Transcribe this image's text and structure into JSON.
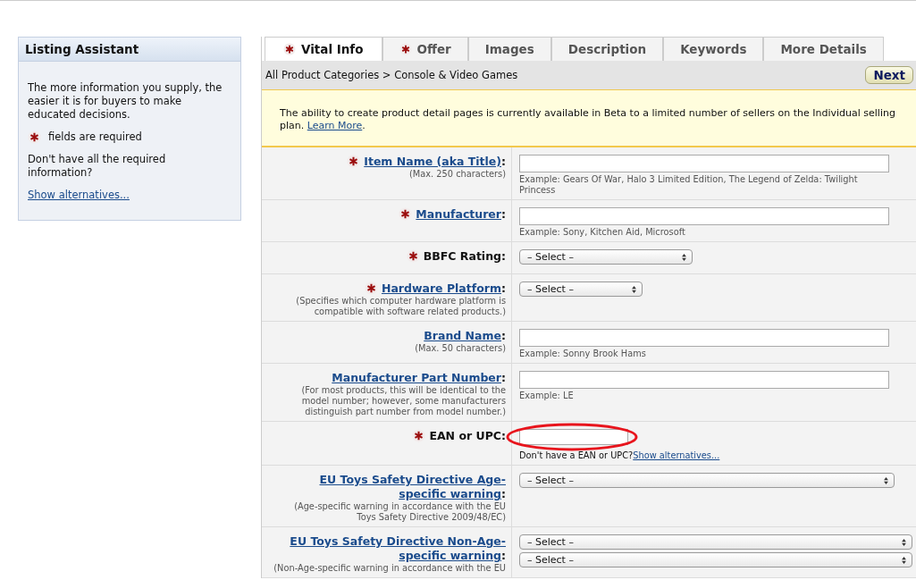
{
  "assistant": {
    "title": "Listing Assistant",
    "intro": "The more information you supply, the easier it is for buyers to make educated decisions.",
    "required_note": "fields are required",
    "missing_text": "Don't have all the required information?",
    "missing_link": "Show alternatives..."
  },
  "tabs": [
    {
      "label": "Vital Info",
      "required": true,
      "selected": true
    },
    {
      "label": "Offer",
      "required": true,
      "selected": false
    },
    {
      "label": "Images",
      "required": false,
      "selected": false
    },
    {
      "label": "Description",
      "required": false,
      "selected": false
    },
    {
      "label": "Keywords",
      "required": false,
      "selected": false
    },
    {
      "label": "More Details",
      "required": false,
      "selected": false
    }
  ],
  "breadcrumb": "All Product Categories > Console & Video Games",
  "next_button": "Next",
  "notice": {
    "text": "The ability to create product detail pages is currently available in Beta to a limited number of sellers on the Individual selling plan. ",
    "link": "Learn More",
    "end": "."
  },
  "fields": [
    {
      "label": "Item Name (aka Title)",
      "colon": ":",
      "required": true,
      "link": true,
      "note": "(Max. 250 characters)",
      "kind": "text",
      "example": "Example: Gears Of War, Halo 3 Limited Edition, The Legend of Zelda: Twilight Princess"
    },
    {
      "label": "Manufacturer",
      "colon": ":",
      "required": true,
      "link": true,
      "kind": "text",
      "example": "Example: Sony, Kitchen Aid, Microsoft"
    },
    {
      "label": "BBFC Rating:",
      "required": true,
      "link": false,
      "kind": "midselect",
      "selects": [
        "– Select –"
      ]
    },
    {
      "label": "Hardware Platform",
      "colon": ":",
      "required": true,
      "link": true,
      "note": "(Specifies which computer hardware platform is compatible with software related products.)",
      "kind": "shortselect",
      "selects": [
        "– Select –"
      ]
    },
    {
      "label": "Brand Name",
      "colon": ":",
      "required": false,
      "link": true,
      "note": "(Max. 50 characters)",
      "kind": "text",
      "example": "Example: Sonny Brook Hams"
    },
    {
      "label": "Manufacturer Part Number",
      "colon": ":",
      "required": false,
      "link": true,
      "note": "(For most products, this will be identical to the model number; however, some manufacturers distinguish part number from model number.)",
      "kind": "text",
      "example": "Example: LE"
    },
    {
      "label": "EAN or UPC:",
      "required": true,
      "link": false,
      "kind": "code",
      "circled": true,
      "help": "Don't have a EAN or UPC?",
      "help_link": "Show alternatives..."
    },
    {
      "label": "EU Toys Safety Directive Age-specific warning",
      "colon": ":",
      "required": false,
      "link": true,
      "note": "(Age-specific warning in accordance with the EU Toys Safety Directive 2009/48/EC)",
      "kind": "wideselect",
      "selects": [
        "– Select –"
      ]
    },
    {
      "label": "EU Toys Safety Directive Non-Age-specific warning",
      "colon": ":",
      "required": false,
      "link": true,
      "note": "(Non-Age-specific warning in accordance with the EU",
      "kind": "fullselect",
      "selects": [
        "– Select –",
        "– Select –"
      ]
    }
  ]
}
